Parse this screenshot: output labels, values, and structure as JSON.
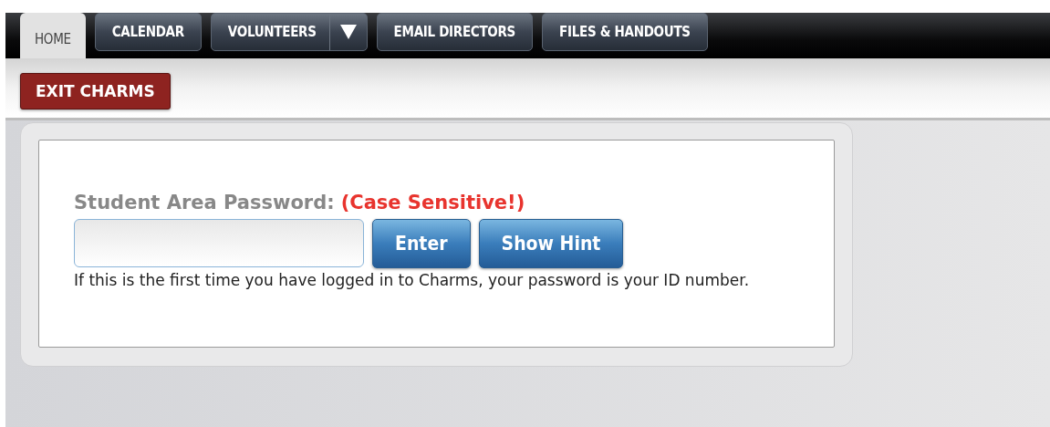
{
  "tabs": [
    {
      "label": "HOME",
      "selected": true,
      "kind": "tab"
    },
    {
      "label": "CALENDAR",
      "selected": false,
      "kind": "tab"
    },
    {
      "label": "VOLUNTEERS",
      "selected": false,
      "kind": "dropdown"
    },
    {
      "label": "EMAIL DIRECTORS",
      "selected": false,
      "kind": "tab"
    },
    {
      "label": "FILES & HANDOUTS",
      "selected": false,
      "kind": "tab"
    }
  ],
  "exit_button": "EXIT CHARMS",
  "login": {
    "label": "Student Area Password:",
    "note": "(Case Sensitive!)",
    "buttons": [
      "Enter",
      "Show Hint"
    ],
    "help": "If this is the first time you have logged in to Charms, your password is your ID number."
  }
}
